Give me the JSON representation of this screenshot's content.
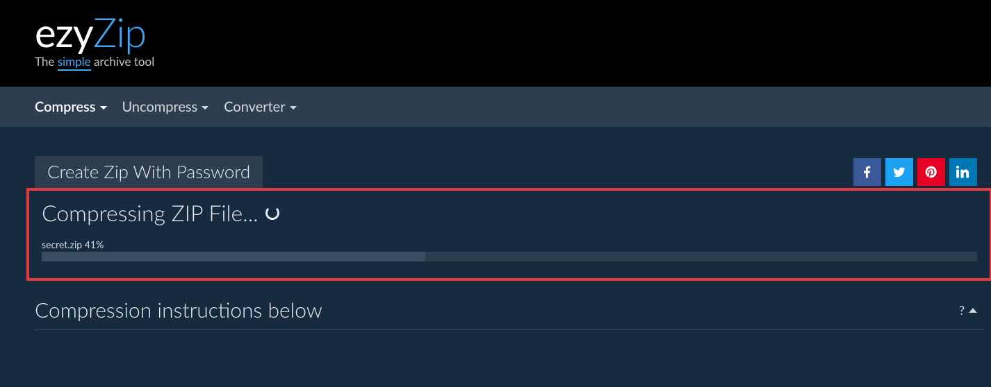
{
  "brand": {
    "part1": "ezy",
    "part2": "Zip"
  },
  "tagline": {
    "pre": "The ",
    "mid": "simple",
    "post": " archive tool"
  },
  "nav": {
    "items": [
      {
        "label": "Compress",
        "active": true
      },
      {
        "label": "Uncompress",
        "active": false
      },
      {
        "label": "Converter",
        "active": false
      }
    ]
  },
  "tab": {
    "label": "Create Zip With Password"
  },
  "social": {
    "facebook": "facebook-icon",
    "twitter": "twitter-icon",
    "pinterest": "pinterest-icon",
    "linkedin": "linkedin-icon"
  },
  "progress": {
    "title": "Compressing ZIP File...",
    "file": "secret.zip",
    "percent": 41,
    "percent_label": "41%"
  },
  "instructions": {
    "title": "Compression instructions below"
  },
  "help": {
    "label": "?"
  },
  "colors": {
    "accent": "#3fa9f5",
    "highlight_border": "#e33b3b",
    "nav_bg": "#2c3e50",
    "page_bg": "#162b40"
  }
}
